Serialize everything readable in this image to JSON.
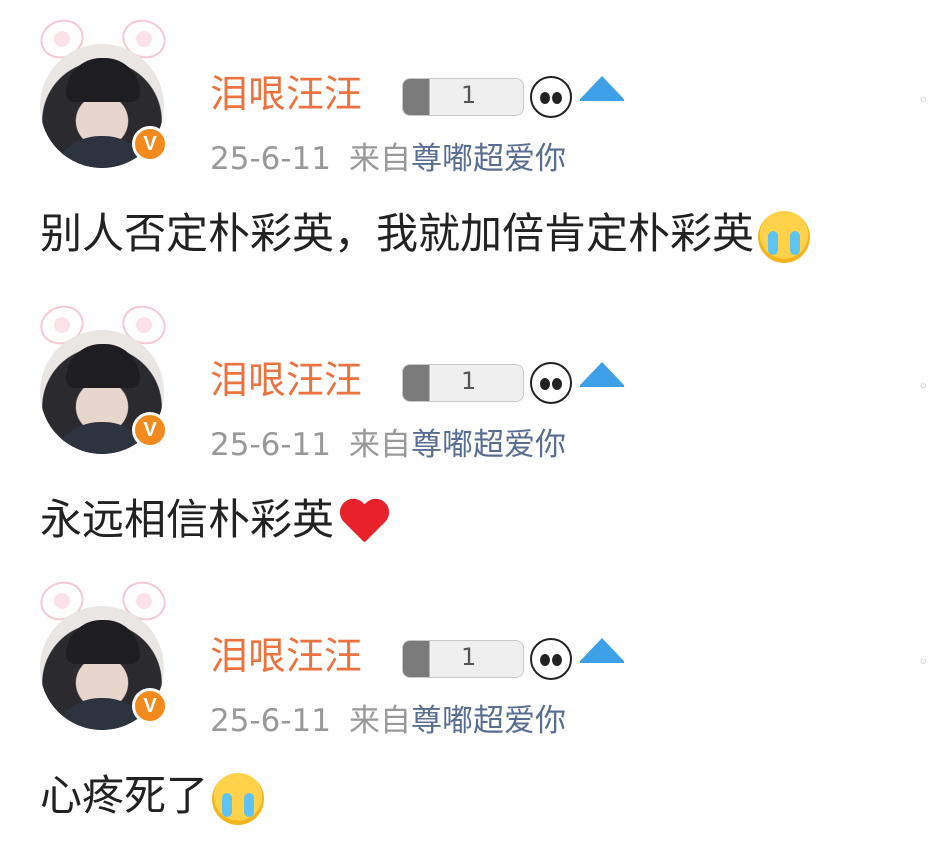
{
  "posts": [
    {
      "user": {
        "name": "泪哏汪汪",
        "medal_text": "1",
        "verified": "V"
      },
      "time": "25-6-11",
      "from_label": "来自",
      "source": "尊嘟超爱你",
      "text": "别人否定朴彩英，我就加倍肯定朴彩英",
      "emoji": "crying-face-icon"
    },
    {
      "user": {
        "name": "泪哏汪汪",
        "medal_text": "1",
        "verified": "V"
      },
      "time": "25-6-11",
      "from_label": "来自",
      "source": "尊嘟超爱你",
      "text": "永远相信朴彩英",
      "emoji": "red-heart-icon"
    },
    {
      "user": {
        "name": "泪哏汪汪",
        "medal_text": "1",
        "verified": "V"
      },
      "time": "25-6-11",
      "from_label": "来自",
      "source": "尊嘟超爱你",
      "text": "心疼死了",
      "emoji": "crying-face-icon"
    }
  ],
  "colors": {
    "name": "#eb7340",
    "source": "#5a6d92",
    "meta": "#999999",
    "text": "#222222",
    "badge": "#f28a1e"
  }
}
